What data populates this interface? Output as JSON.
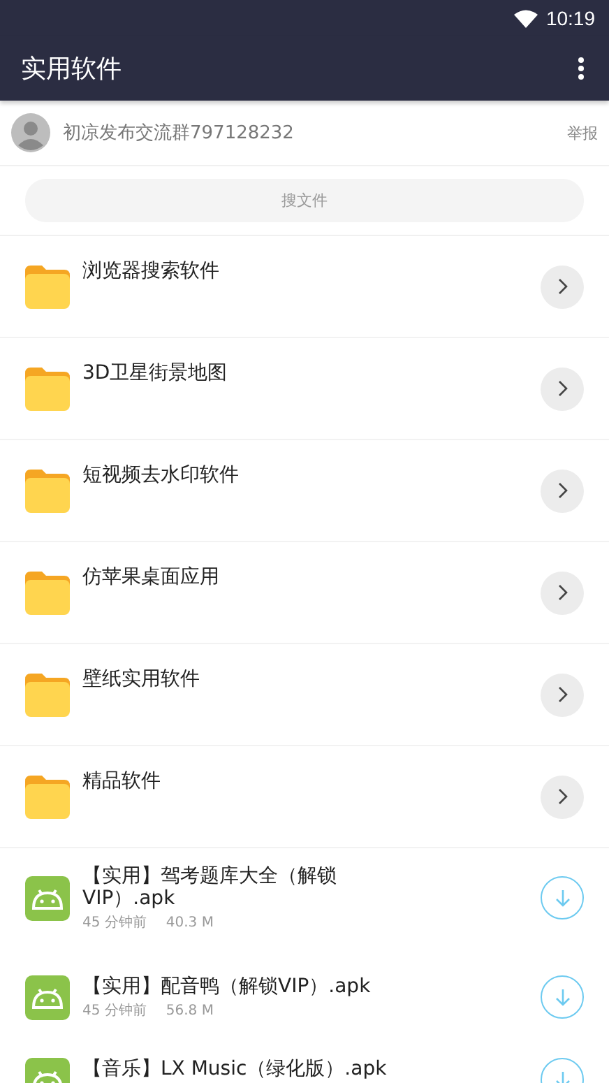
{
  "status_bar": {
    "time": "10:19"
  },
  "toolbar": {
    "title": "实用软件"
  },
  "group": {
    "text": "初凉发布交流群797128232",
    "report": "举报"
  },
  "search": {
    "placeholder": "搜文件"
  },
  "items": [
    {
      "kind": "folder",
      "name": "浏览器搜索软件"
    },
    {
      "kind": "folder",
      "name": "3D卫星街景地图"
    },
    {
      "kind": "folder",
      "name": "短视频去水印软件"
    },
    {
      "kind": "folder",
      "name": "仿苹果桌面应用"
    },
    {
      "kind": "folder",
      "name": "壁纸实用软件"
    },
    {
      "kind": "folder",
      "name": "精品软件"
    },
    {
      "kind": "file",
      "name": "【实用】驾考题库大全（解锁VIP）.apk",
      "time": "45 分钟前",
      "size": "40.3 M"
    },
    {
      "kind": "file",
      "name": "【实用】配音鸭（解锁VIP）.apk",
      "time": "45 分钟前",
      "size": "56.8 M"
    },
    {
      "kind": "file",
      "name": "【音乐】LX Music（绿化版）.apk"
    }
  ]
}
